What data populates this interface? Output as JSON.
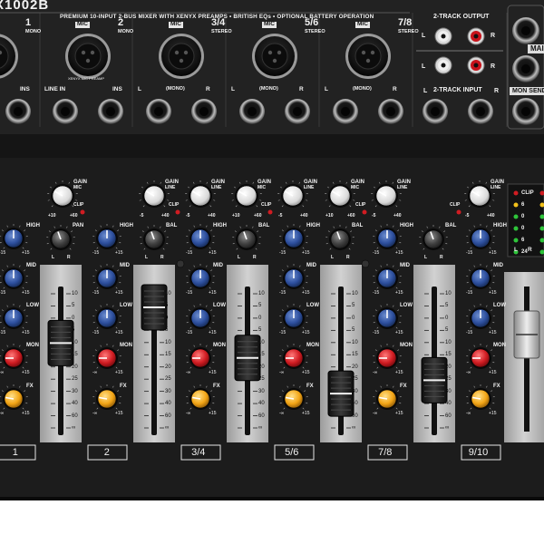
{
  "header": {
    "model_fragment": "X1002B",
    "tagline": "PREMIUM 10-INPUT 2-BUS MIXER WITH XENYX PREAMPS • BRITISH EQs • OPTIONAL BATTERY OPERATION"
  },
  "inputs": [
    {
      "name": "1",
      "num": "1",
      "kind": "MONO",
      "jack_left": "",
      "jack_right": "INS"
    },
    {
      "name": "2",
      "num": "2",
      "kind": "MONO",
      "jack_left": "LINE IN",
      "jack_right": "INS",
      "note": "XENYX MIC PREAMP"
    },
    {
      "name": "3/4",
      "num": "3/4",
      "kind": "STEREO",
      "jack_left": "L",
      "jack_mid": "(MONO)",
      "jack_right": "R"
    },
    {
      "name": "5/6",
      "num": "5/6",
      "kind": "STEREO",
      "jack_left": "L",
      "jack_mid": "(MONO)",
      "jack_right": "R"
    },
    {
      "name": "7/8",
      "num": "7/8",
      "kind": "STEREO",
      "jack_left": "L",
      "jack_mid": "(MONO)",
      "jack_right": "R"
    }
  ],
  "mic_badge": "MIC",
  "rca": {
    "output_title": "2-TRACK OUTPUT",
    "input_title": "2-TRACK INPUT",
    "left": "L",
    "right": "R"
  },
  "right_labels": {
    "main": "MAI",
    "mon_send": "MON SEND"
  },
  "knob_labels": {
    "gain": "GAIN",
    "mic": "MIC",
    "line": "LINE",
    "clip": "CLIP",
    "pan": "PAN",
    "bal": "BAL",
    "high": "HIGH",
    "mid": "MID",
    "low": "LOW",
    "mon": "MON",
    "fx": "FX",
    "gain_lo_mic": "+10",
    "gain_hi_mic": "+60",
    "gain_lo_line": "-5",
    "gain_hi_line": "+40",
    "eq_lo": "-15",
    "eq_hi": "+15",
    "send_lo": "-∞",
    "send_hi": "+15",
    "l": "L",
    "r": "R"
  },
  "fader_scale": [
    "10",
    "5",
    "0",
    "5",
    "10",
    "15",
    "20",
    "25",
    "30",
    "40",
    "60",
    "∞"
  ],
  "fader_levels": [
    0.62,
    0.86,
    0.52,
    0.28,
    0.37
  ],
  "channel_strips": [
    "1",
    "2",
    "3/4",
    "5/6",
    "7/8",
    "9/10"
  ],
  "meter": [
    "CLIP",
    "6",
    "0",
    "0",
    "6",
    "24"
  ],
  "meter_sides": {
    "left": "L",
    "right": "R"
  }
}
